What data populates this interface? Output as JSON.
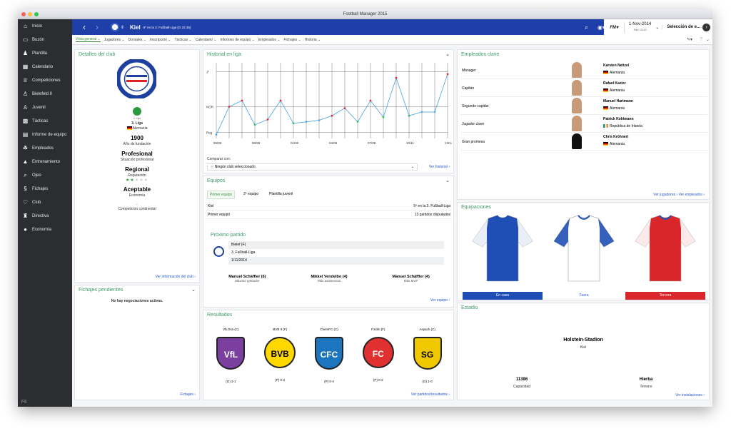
{
  "window": {
    "title": "Football Manager 2015"
  },
  "sidebar": {
    "items": [
      {
        "label": "Inicio",
        "icon": "home-icon"
      },
      {
        "label": "Buzón",
        "icon": "inbox-icon"
      },
      {
        "label": "Plantilla",
        "icon": "squad-icon"
      },
      {
        "label": "Calendario",
        "icon": "calendar-icon"
      },
      {
        "label": "Competiciones",
        "icon": "trophy-icon"
      },
      {
        "label": "Bielefeld II",
        "icon": "team-icon"
      },
      {
        "label": "Juvenil",
        "icon": "youth-icon"
      },
      {
        "label": "Tácticas",
        "icon": "tactics-icon"
      },
      {
        "label": "Informe de equipo",
        "icon": "report-icon"
      },
      {
        "label": "Empleados",
        "icon": "staff-icon"
      },
      {
        "label": "Entrenamiento",
        "icon": "training-icon"
      },
      {
        "label": "Ojeo",
        "icon": "scout-icon"
      },
      {
        "label": "Fichajes",
        "icon": "transfers-icon"
      },
      {
        "label": "Club",
        "icon": "club-icon"
      },
      {
        "label": "Directiva",
        "icon": "board-icon"
      },
      {
        "label": "Economía",
        "icon": "finance-icon"
      }
    ],
    "footer": "FS"
  },
  "topbar": {
    "team": "Kiel",
    "position": "5º en la 3. Fußball-Liga (G 22:45)",
    "date": "1-Nov-2014",
    "date_sub": "Sáb 13:00",
    "continue": "Selección de e..."
  },
  "subnav": [
    "Vista general",
    "Jugadores",
    "Dorsales",
    "Inscripción",
    "Tácticas",
    "Calendario",
    "Informes de equipo",
    "Empleados",
    "Fichajes",
    "Historia"
  ],
  "club": {
    "title": "Detalles del club",
    "league": "3. Liga",
    "country": "Alemania",
    "founded": "1900",
    "founded_label": "Año de fundación",
    "status": "Profesional",
    "status_label": "Situación profesional",
    "reputation": "Regional",
    "reputation_label": "Reputación",
    "reputation_stars": 2,
    "economy": "Aceptable",
    "economy_label": "Economía",
    "continental": "-",
    "continental_label": "Competición continental",
    "link": "Ver información del club"
  },
  "history": {
    "title": "Historial en liga",
    "compare_label": "Comparar con:",
    "compare_value": "Ningún club seleccionado",
    "link": "Ver historial",
    "y_labels": [
      "1º",
      "NOR",
      "Reg"
    ],
    "x_labels": [
      "95/96",
      "98/99",
      "01/02",
      "04/05",
      "07/08",
      "10/11",
      "13/14"
    ]
  },
  "chart_data": {
    "type": "line",
    "x": [
      "95/96",
      "96/97",
      "97/98",
      "98/99",
      "99/00",
      "00/01",
      "01/02",
      "02/03",
      "03/04",
      "04/05",
      "05/06",
      "06/07",
      "07/08",
      "08/09",
      "09/10",
      "10/11",
      "11/12",
      "12/13",
      "13/14"
    ],
    "values": [
      0.05,
      0.42,
      0.5,
      0.18,
      0.25,
      0.5,
      0.2,
      0.22,
      0.24,
      0.3,
      0.4,
      0.22,
      0.5,
      0.28,
      0.8,
      0.3,
      0.35,
      0.35,
      0.85
    ]
  },
  "teams": {
    "title": "Equipos",
    "tabs": [
      "Primer equipo",
      "2º equipo",
      "Plantilla juvenil"
    ],
    "rows": [
      {
        "name": "Kiel",
        "value": "5º en la 3. Fußball-Liga"
      },
      {
        "name": "Primer equipo",
        "value": "13 partidos disputados"
      }
    ],
    "next_title": "Próximo partido",
    "next": [
      "Bielef (F)",
      "3. Fußball-Liga",
      "1/11/2014"
    ],
    "stats": [
      {
        "name": "Manuel Schäffler (6)",
        "label": "Máximo goleador"
      },
      {
        "name": "Mikkel Vendelbo (4)",
        "label": "Más asistencias"
      },
      {
        "name": "Manuel Schäffler (4)",
        "label": "Más MVP"
      }
    ],
    "link": "Ver equipo"
  },
  "transfers": {
    "title": "Fichajes pendientes",
    "message": "No hay negociaciones activas.",
    "link": "Fichajes"
  },
  "results": {
    "title": "Resultados",
    "items": [
      {
        "team": "VfLOsn (C)",
        "score": "(G) 3-1"
      },
      {
        "team": "BVB II (F)",
        "score": "(P) 0-2"
      },
      {
        "team": "ChemFC (C)",
        "score": "(P) 0-4"
      },
      {
        "team": "F.Köln (F)",
        "score": "(P) 0-2"
      },
      {
        "team": "Aspach (C)",
        "score": "(G) 1-0"
      }
    ],
    "link": "Ver partidos/resultados"
  },
  "staff": {
    "title": "Empleados clave",
    "rows": [
      {
        "role": "Mánager",
        "name": "Karsten Neitzel",
        "nation": "Alemania"
      },
      {
        "role": "Capitán",
        "name": "Rafael Kazior",
        "nation": "Alemania"
      },
      {
        "role": "Segundo capitán",
        "name": "Manuel Hartmann",
        "nation": "Alemania"
      },
      {
        "role": "Jugador clave",
        "name": "Patrick Kohlmann",
        "nation": "República de Irlanda"
      },
      {
        "role": "Gran promesa",
        "name": "Chris Kröhnert",
        "nation": "Alemania"
      }
    ],
    "link1": "Ver jugadores",
    "link2": "Ver empleados"
  },
  "kits": {
    "title": "Equipaciones",
    "labels": [
      "En casa",
      "Fuera",
      "Tercera"
    ],
    "colors": [
      "#1f4fb4",
      "#ffffff",
      "#d9262a"
    ]
  },
  "stadium": {
    "title": "Estadio",
    "name": "Holstein-Stadion",
    "city": "Kiel",
    "capacity": "11386",
    "capacity_label": "Capacidad",
    "surface": "Hierba",
    "surface_label": "Terreno",
    "link": "Ver instalaciones"
  }
}
